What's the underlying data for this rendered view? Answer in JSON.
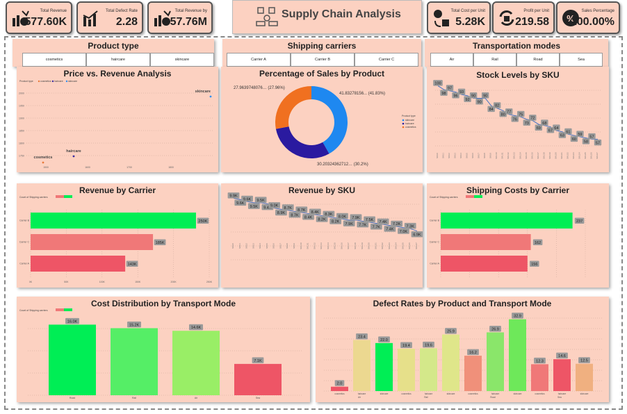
{
  "header": {
    "title": "Supply Chain Analysis",
    "kpis": [
      {
        "label": "Total Revenue",
        "value": "577.60K",
        "icon": "money-bag-chart-icon"
      },
      {
        "label": "Total Defect Rate",
        "value": "2.28",
        "icon": "bar-chart-icon"
      },
      {
        "label": "Total Revenue by",
        "value": "57.76M",
        "icon": "money-bag-chart-icon"
      },
      {
        "label": "Total Cost per Unit",
        "value": "5.28K",
        "icon": "cost-cycle-icon"
      },
      {
        "label": "Profit per Unit",
        "value": "219.58",
        "icon": "profit-arrows-icon"
      },
      {
        "label": "Sales Percentage",
        "value": "100.00%",
        "icon": "percent-badge-icon"
      }
    ]
  },
  "slicers": {
    "product_type": {
      "title": "Product type",
      "options": [
        "cosmetics",
        "haircare",
        "skincare"
      ]
    },
    "shipping_carriers": {
      "title": "Shipping carriers",
      "options": [
        "Carrier A",
        "Carrier B",
        "Carrier C"
      ]
    },
    "transport_modes": {
      "title": "Transportation modes",
      "options": [
        "Air",
        "Rail",
        "Road",
        "Sea"
      ]
    }
  },
  "colors": {
    "panel": "#fcd1c1",
    "green": "#00ee55",
    "salmon": "#f07878",
    "red": "#ee5566",
    "blue": "#4472c4"
  },
  "chart_data": [
    {
      "id": "price_revenue",
      "type": "scatter",
      "title": "Price vs. Revenue Analysis",
      "legend_title": "Product type",
      "legend": [
        "cosmetics",
        "haircare",
        "skincare"
      ],
      "legend_colors": [
        "#e87a3a",
        "#3a2ba0",
        "#2f8ff0"
      ],
      "points": [
        {
          "label": "cosmetics",
          "x": 1550,
          "y": 1750,
          "color": "#e87a3a"
        },
        {
          "label": "haircare",
          "x": 1570,
          "y": 1800,
          "color": "#3a2ba0"
        },
        {
          "label": "skincare",
          "x": 1790,
          "y": 2000,
          "color": "#2f8ff0"
        }
      ],
      "y_ticks": [
        "2000",
        "1950",
        "1900",
        "1850",
        "1800",
        "1750"
      ],
      "x_ticks": [
        "1500",
        "1600",
        "1700",
        "1800"
      ]
    },
    {
      "id": "sales_pct",
      "type": "pie",
      "title": "Percentage of Sales by Product",
      "legend_title": "Product type",
      "legend": [
        "skincare",
        "haircare",
        "cosmetics"
      ],
      "slices": [
        {
          "label": "skincare",
          "value": 41.83,
          "text": "41.83278156... (41.83%)",
          "color": "#1e88f0"
        },
        {
          "label": "haircare",
          "value": 30.2,
          "text": "30.20324362712… (30.2%)",
          "color": "#2a1aa0"
        },
        {
          "label": "cosmetics",
          "value": 27.96,
          "text": "27.9639748076… (27.96%)",
          "color": "#f07020"
        }
      ]
    },
    {
      "id": "stock_sku",
      "type": "line",
      "title": "Stock Levels by SKU",
      "values": [
        100,
        97,
        96,
        95,
        93,
        92,
        90,
        90,
        90,
        84,
        82,
        80,
        77,
        76,
        75,
        73,
        72,
        69,
        68,
        67,
        64,
        63,
        61,
        60,
        59,
        58,
        57,
        57
      ],
      "labels": [
        "100",
        "98",
        "97",
        "96",
        "93",
        "92",
        "90",
        "90",
        "90",
        "84",
        "82",
        "80",
        "77",
        "76",
        "75",
        "73",
        "72",
        "69",
        "68",
        "67",
        "64",
        "63",
        "61",
        "60",
        "59",
        "58",
        "57",
        "57"
      ]
    },
    {
      "id": "revenue_carrier",
      "type": "bar",
      "title": "Revenue by Carrier",
      "legend_title": "Count of Shipping carriers",
      "categories": [
        "Carrier B",
        "Carrier C",
        "Carrier A"
      ],
      "values": [
        250,
        185,
        143
      ],
      "value_labels": [
        "250K",
        "185K",
        "143K"
      ],
      "colors": [
        "#00ee55",
        "#f07878",
        "#ee5566"
      ],
      "x_ticks": [
        "0K",
        "50K",
        "100K",
        "150K",
        "200K",
        "250K"
      ],
      "xlim": [
        0,
        270
      ]
    },
    {
      "id": "revenue_sku",
      "type": "line",
      "title": "Revenue by SKU",
      "values": [
        9.9,
        9.8,
        9.6,
        9.5,
        9.5,
        9.4,
        9.0,
        8.9,
        8.8,
        8.7,
        8.6,
        8.5,
        8.4,
        8.3,
        8.2,
        8.1,
        8.0,
        7.9,
        7.9,
        7.8,
        7.7,
        7.6,
        7.5,
        7.4,
        7.3,
        7.2,
        7.1,
        6.9
      ],
      "labels": [
        "9.9K",
        "9.6K",
        "9.6K",
        "9.5K",
        "9.5K",
        "9.4K",
        "9.0K",
        "8.9K",
        "8.7K",
        "8.7K",
        "8.7K",
        "8.4K",
        "8.4K",
        "8.2K",
        "8.3K",
        "8.2K",
        "8.0K",
        "7.9K",
        "7.9K",
        "7.7K",
        "7.5K",
        "7.7K",
        "7.4K",
        "7.4K",
        "7.2K",
        "7.0K",
        "7.3K",
        "6.9K"
      ]
    },
    {
      "id": "shipping_carrier",
      "type": "bar",
      "title": "Shipping Costs by Carrier",
      "legend_title": "Count of Shipping carriers",
      "categories": [
        "Carrier B",
        "Carrier C",
        "Carrier A"
      ],
      "values": [
        237,
        162,
        156
      ],
      "value_labels": [
        "237",
        "162",
        "156"
      ],
      "colors": [
        "#00ee55",
        "#f07878",
        "#ee5566"
      ],
      "xlim": [
        0,
        260
      ]
    },
    {
      "id": "cost_transport",
      "type": "bar",
      "title": "Cost Distribution by Transport Mode",
      "legend_title": "Count of Shipping carriers",
      "categories": [
        "Road",
        "Rail",
        "Air",
        "Sea"
      ],
      "values": [
        16.0,
        15.2,
        14.6,
        7.1
      ],
      "value_labels": [
        "16.0K",
        "15.2K",
        "14.6K",
        "7.1K"
      ],
      "colors": [
        "#00ee55",
        "#55ee66",
        "#99ee66",
        "#ee5566"
      ],
      "ylim": [
        0,
        17
      ]
    },
    {
      "id": "defect_rates",
      "type": "bar",
      "title": "Defect Rates by Product and Transport Mode",
      "categories": [
        "cosmetics",
        "haircare",
        "skincare",
        "cosmetics",
        "haircare",
        "skincare",
        "cosmetics",
        "haircare",
        "skincare",
        "cosmetics",
        "haircare",
        "skincare"
      ],
      "groups": [
        "Air",
        "",
        "",
        "Rail",
        "",
        "",
        "Road",
        "",
        "",
        "Sea",
        "",
        ""
      ],
      "values": [
        2.0,
        23.4,
        22.0,
        19.4,
        19.6,
        25.9,
        16.2,
        26.9,
        32.9,
        12.3,
        14.6,
        12.5
      ],
      "value_labels": [
        "2.0",
        "23.4",
        "22.0",
        "19.4",
        "19.6",
        "25.9",
        "16.2",
        "26.9",
        "32.9",
        "12.3",
        "14.6",
        "12.5"
      ],
      "colors": [
        "#ee5566",
        "#ecd890",
        "#00ee55",
        "#e6e08a",
        "#d4e88a",
        "#dfe68a",
        "#f0907a",
        "#8ae66a",
        "#6ee85a",
        "#f07878",
        "#ee5566",
        "#f0b080"
      ],
      "ylim": [
        0,
        35
      ]
    }
  ]
}
